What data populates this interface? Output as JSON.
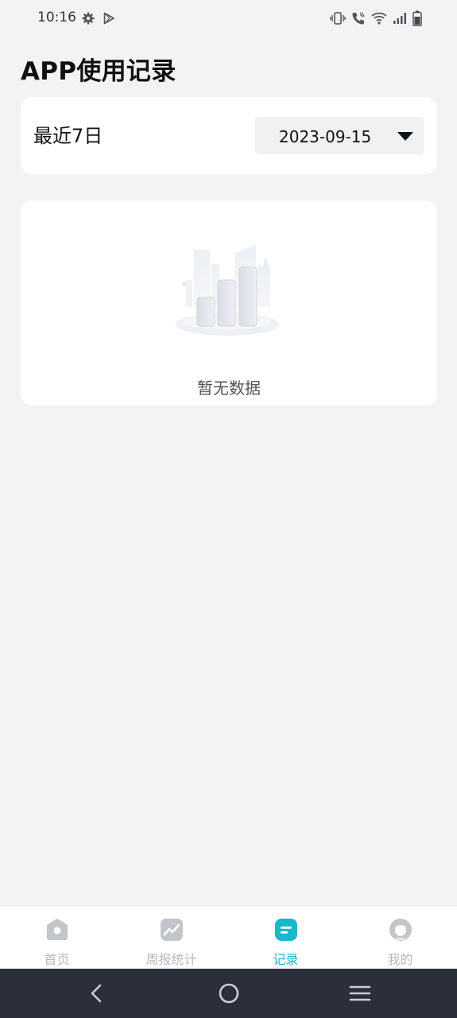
{
  "status_bar": {
    "time": "10:16",
    "icons_left": [
      "gear-icon",
      "play-store-icon"
    ],
    "icons_right": [
      "vibrate-icon",
      "wifi-calling-icon",
      "wifi-icon",
      "signal-icon",
      "battery-icon"
    ]
  },
  "page": {
    "title": "APP使用记录"
  },
  "filter": {
    "label": "最近7日",
    "date_value": "2023-09-15",
    "dropdown_icon": "caret-down-icon"
  },
  "empty_state": {
    "illustration": "empty-chart-illustration",
    "message": "暂无数据"
  },
  "bottom_nav": {
    "items": [
      {
        "label": "首页",
        "icon": "home-icon",
        "active": false
      },
      {
        "label": "周报统计",
        "icon": "trend-chart-icon",
        "active": false
      },
      {
        "label": "记录",
        "icon": "record-icon",
        "active": true
      },
      {
        "label": "我的",
        "icon": "profile-icon",
        "active": false
      }
    ]
  },
  "system_nav": {
    "buttons": [
      "back-icon",
      "home-circle-icon",
      "menu-lines-icon"
    ]
  },
  "colors": {
    "background": "#f2f3f5",
    "card": "#ffffff",
    "accent": "#1ab8c9",
    "inactive": "#b8b9bd",
    "system_bar": "#2a2f3a"
  }
}
